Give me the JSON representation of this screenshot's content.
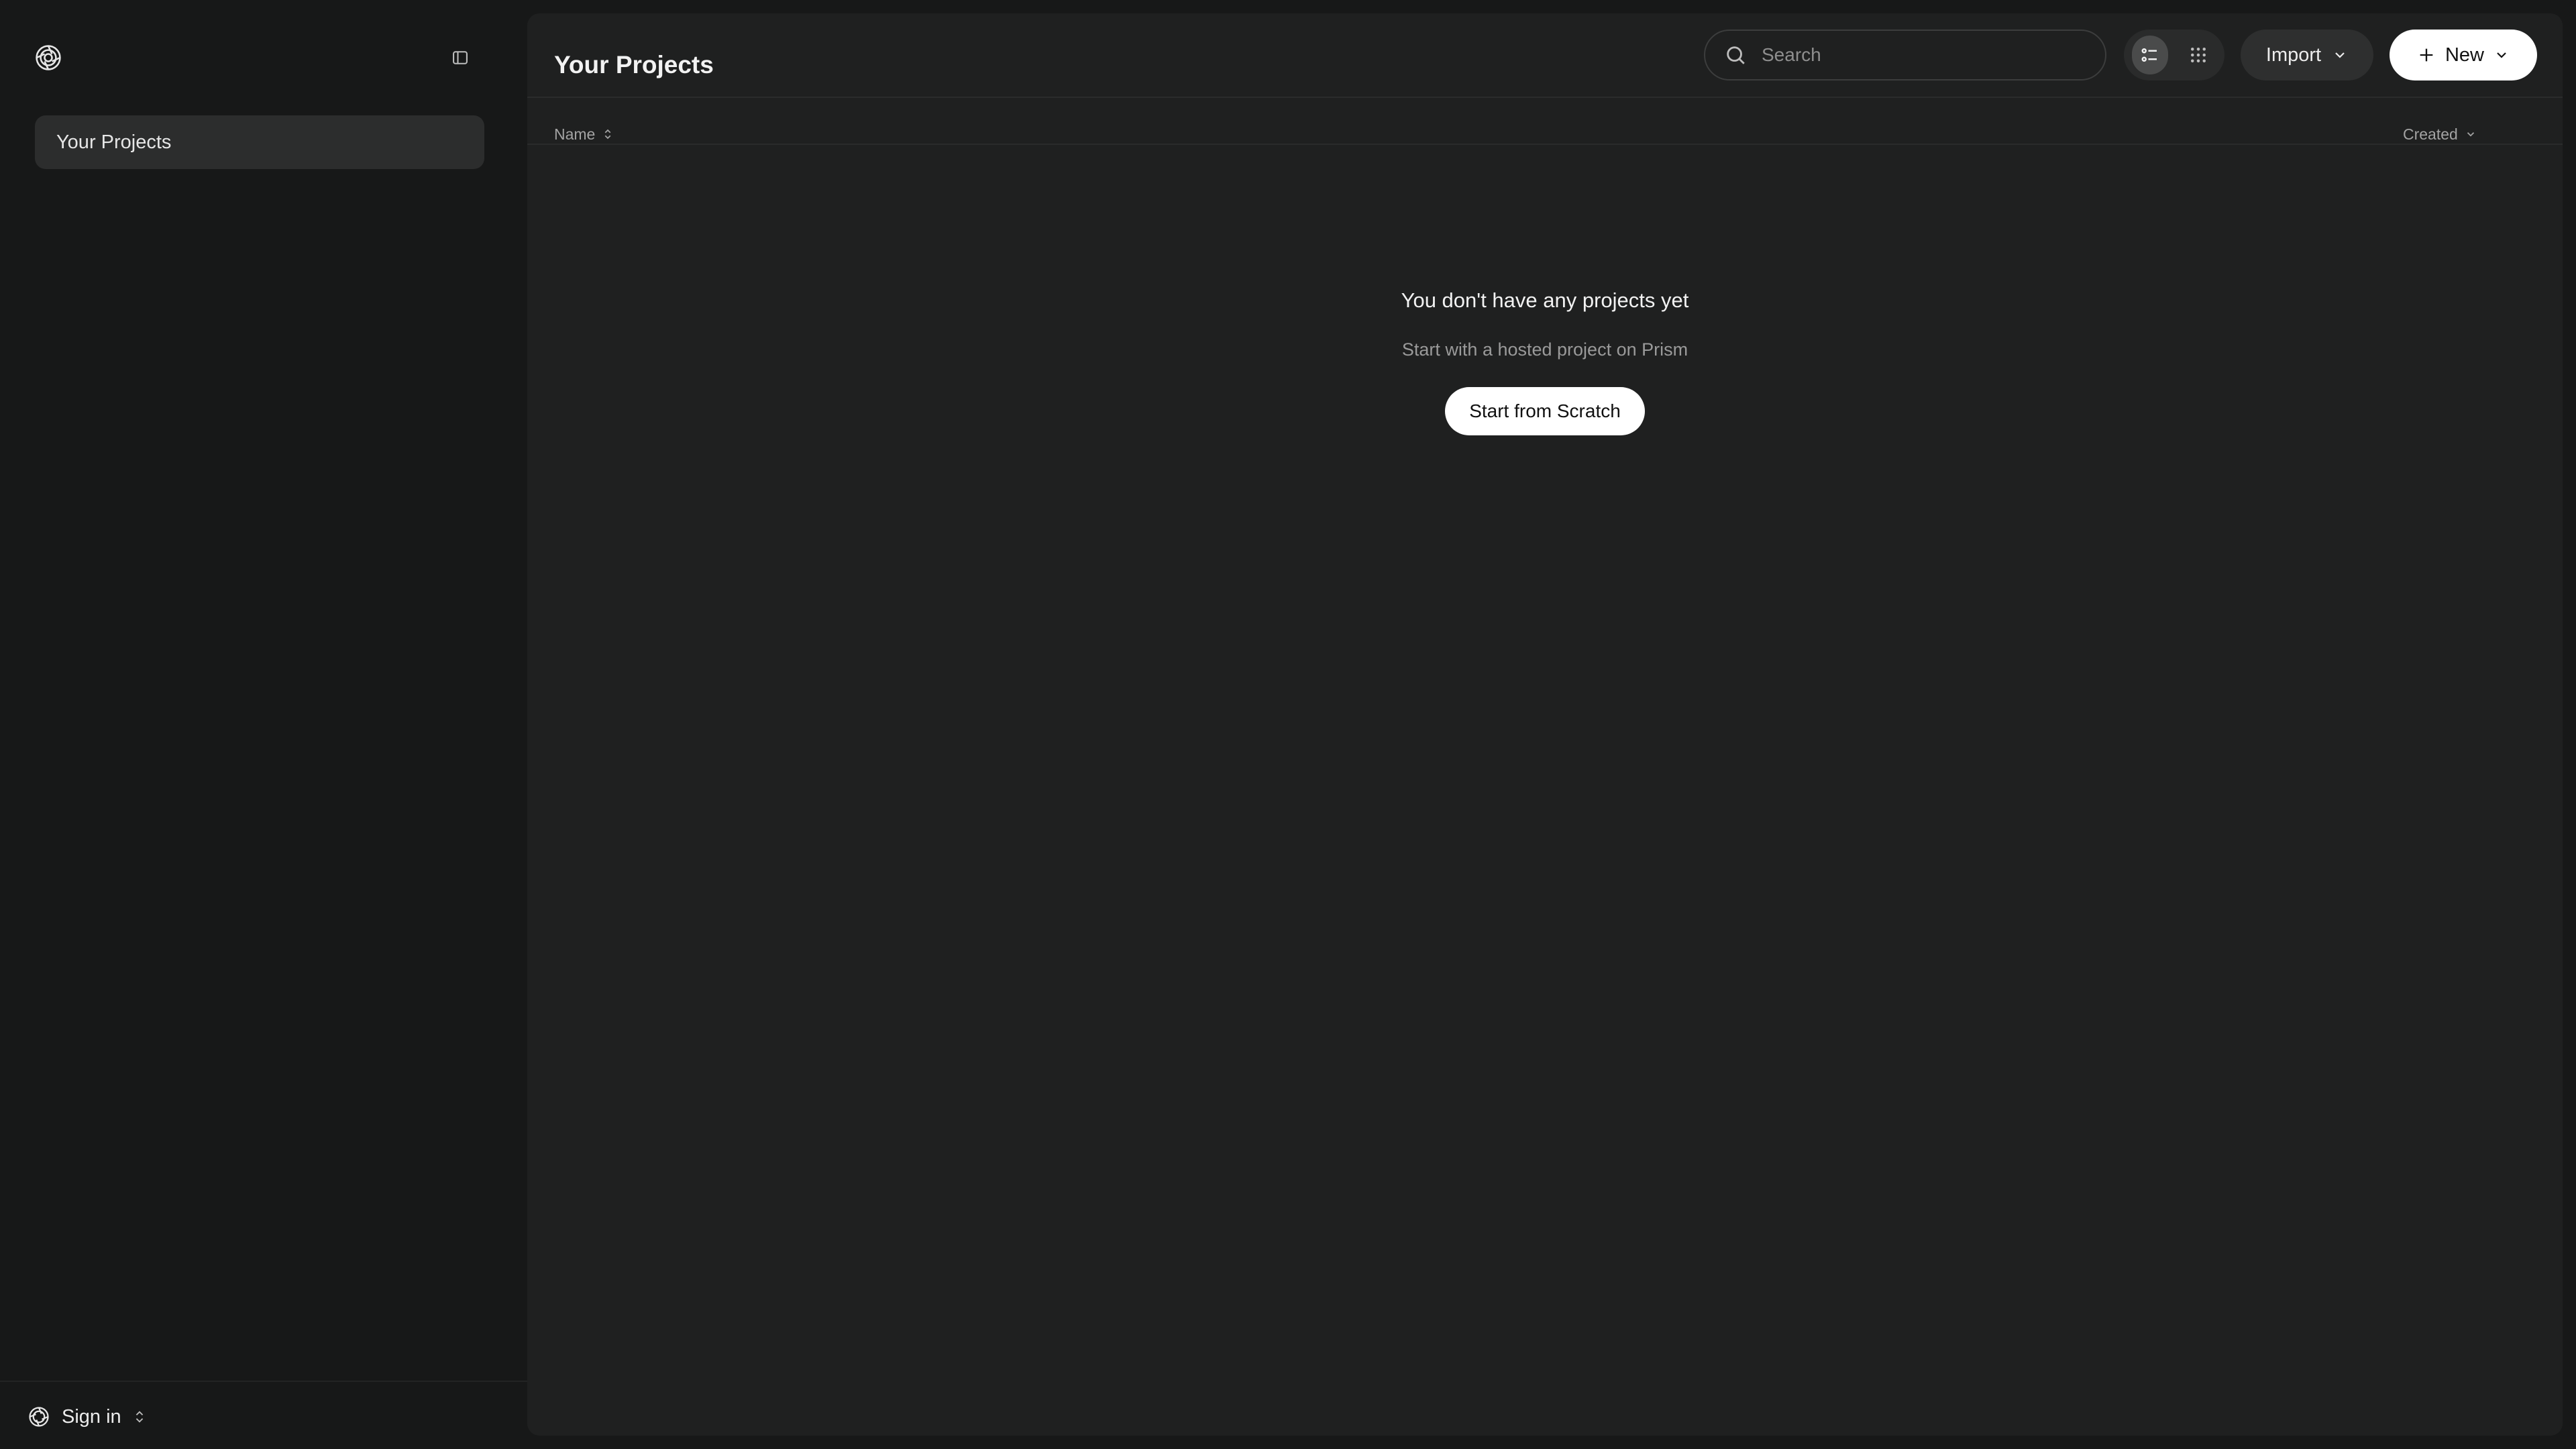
{
  "sidebar": {
    "logo_icon": "openai-logo-icon",
    "collapse_icon": "sidebar-toggle-icon",
    "items": [
      {
        "label": "Your Projects",
        "active": true
      }
    ],
    "footer": {
      "signin_label": "Sign in",
      "icon": "openai-logo-icon",
      "chevron_icon": "chevron-up-down-icon"
    }
  },
  "header": {
    "title": "Your Projects",
    "search": {
      "placeholder": "Search",
      "value": ""
    },
    "view_modes": [
      "list",
      "grid"
    ],
    "active_view": "list",
    "import_label": "Import",
    "new_label": "New"
  },
  "columns": {
    "name_label": "Name",
    "created_label": "Created"
  },
  "empty_state": {
    "title": "You don't have any projects yet",
    "subtitle": "Start with a hosted project on Prism",
    "button_label": "Start from Scratch"
  },
  "colors": {
    "sidebar_bg": "#171818",
    "main_bg": "#1f2020",
    "primary_button_bg": "#ffffff",
    "active_nav_bg": "#2c2d2d"
  }
}
